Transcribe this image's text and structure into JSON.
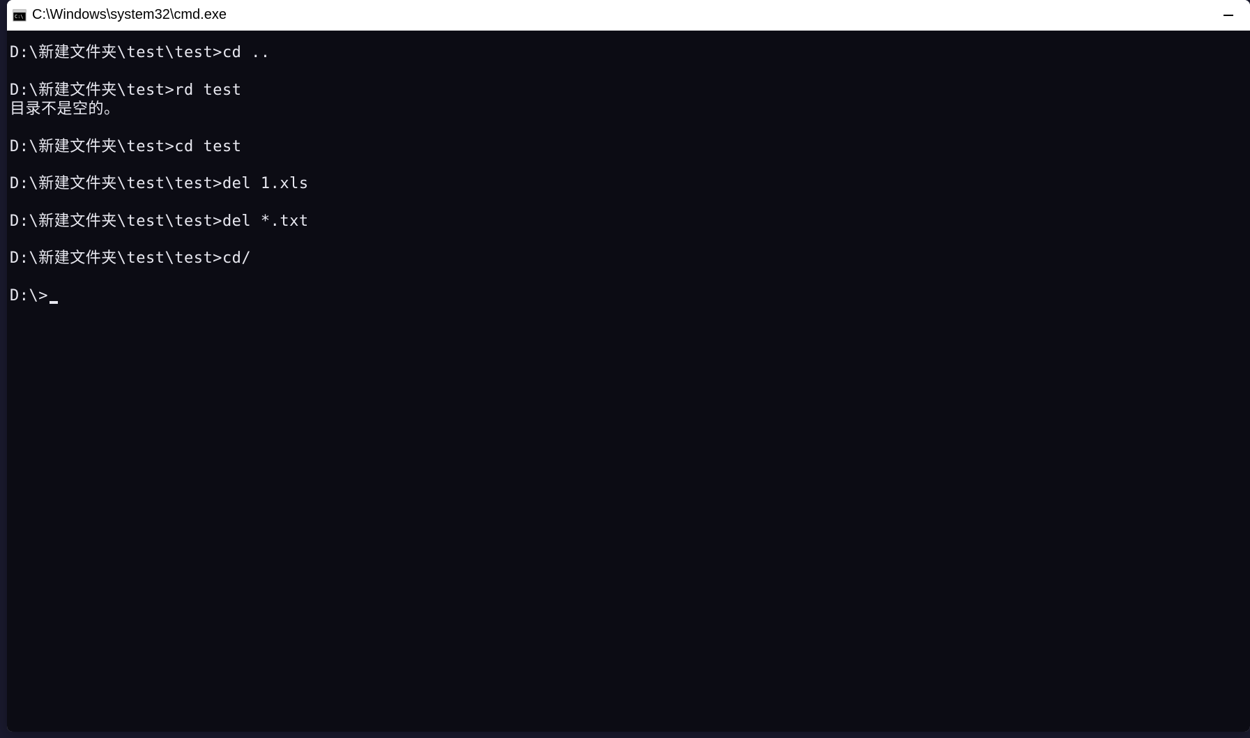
{
  "window": {
    "title": "C:\\Windows\\system32\\cmd.exe"
  },
  "terminal": {
    "entries": [
      {
        "prompt": "D:\\新建文件夹\\test\\test>",
        "command": "cd .."
      },
      {
        "prompt": "D:\\新建文件夹\\test>",
        "command": "rd test",
        "output": "目录不是空的。"
      },
      {
        "prompt": "D:\\新建文件夹\\test>",
        "command": "cd test"
      },
      {
        "prompt": "D:\\新建文件夹\\test\\test>",
        "command": "del 1.xls"
      },
      {
        "prompt": "D:\\新建文件夹\\test\\test>",
        "command": "del *.txt"
      },
      {
        "prompt": "D:\\新建文件夹\\test\\test>",
        "command": "cd/"
      }
    ],
    "current_prompt": "D:\\>"
  }
}
